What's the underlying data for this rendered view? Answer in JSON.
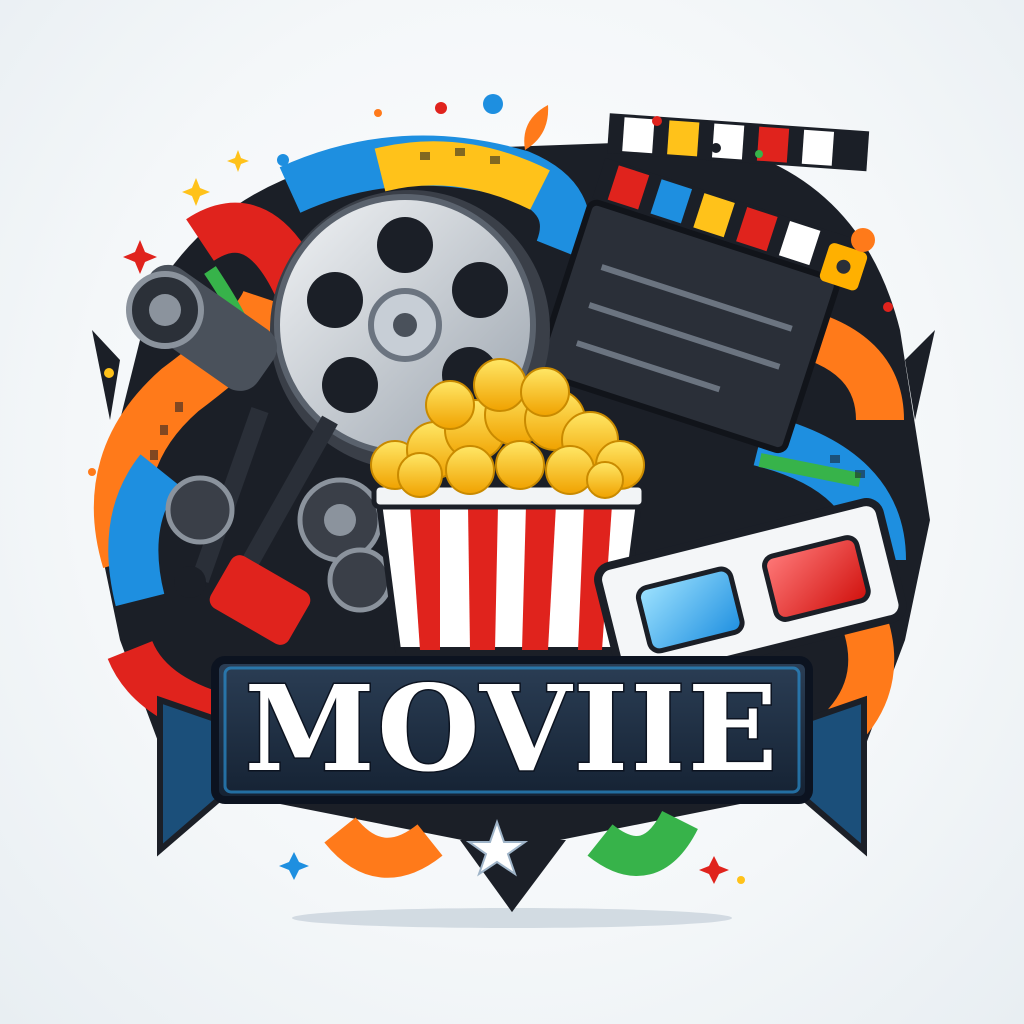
{
  "logo": {
    "title": "MOVIIE",
    "icons": [
      "film-reel-icon",
      "clapperboard-icon",
      "popcorn-icon",
      "3d-glasses-icon",
      "movie-camera-icon",
      "film-strip-icon",
      "star-icon",
      "sparkle-icon"
    ]
  },
  "colors": {
    "background": "#f4f7f9",
    "banner": "#1c2a3a",
    "banner_accent": "#2a8fd0",
    "title_fill": "#ffffff",
    "red": "#e0231d",
    "yellow": "#ffc21a",
    "blue": "#1e8fe0",
    "green": "#37b34a",
    "orange": "#ff7a1a",
    "dark": "#1b1f27"
  }
}
